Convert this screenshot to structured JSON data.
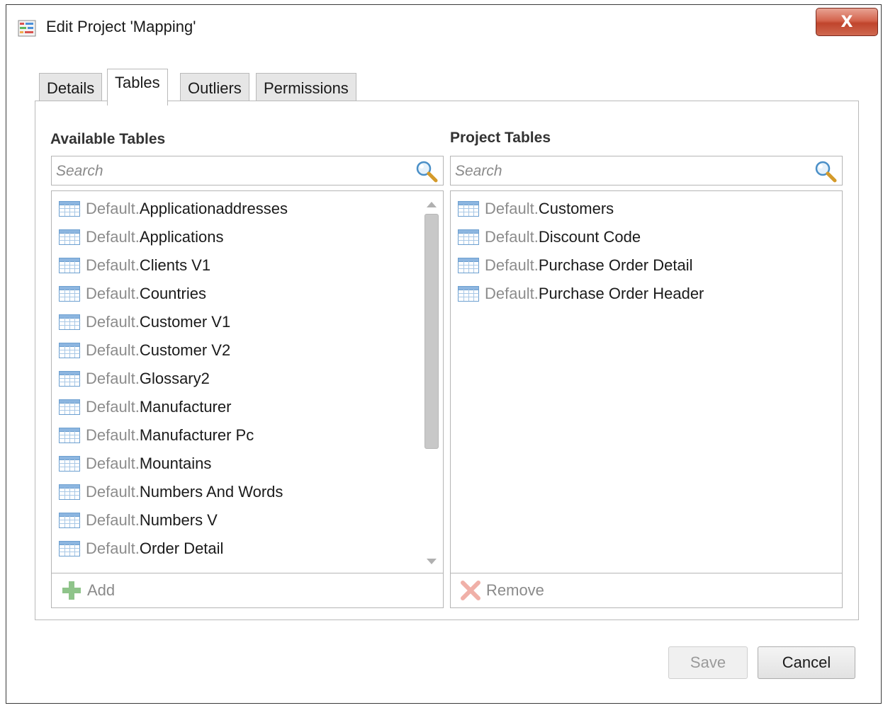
{
  "window": {
    "title": "Edit Project 'Mapping'",
    "close_symbol": "X",
    "close_color": "#c9503a"
  },
  "tabs": [
    {
      "label": "Details",
      "active": false
    },
    {
      "label": "Tables",
      "active": true
    },
    {
      "label": "Outliers",
      "active": false
    },
    {
      "label": "Permissions",
      "active": false
    }
  ],
  "available": {
    "title": "Available Tables",
    "search_placeholder": "Search",
    "items": [
      {
        "prefix": "Default.",
        "name": "Applicationaddresses"
      },
      {
        "prefix": "Default.",
        "name": "Applications"
      },
      {
        "prefix": "Default.",
        "name": "Clients V1"
      },
      {
        "prefix": "Default.",
        "name": "Countries"
      },
      {
        "prefix": "Default.",
        "name": "Customer V1"
      },
      {
        "prefix": "Default.",
        "name": "Customer V2"
      },
      {
        "prefix": "Default.",
        "name": "Glossary2"
      },
      {
        "prefix": "Default.",
        "name": "Manufacturer"
      },
      {
        "prefix": "Default.",
        "name": "Manufacturer Pc"
      },
      {
        "prefix": "Default.",
        "name": "Mountains"
      },
      {
        "prefix": "Default.",
        "name": "Numbers And Words"
      },
      {
        "prefix": "Default.",
        "name": "Numbers V"
      },
      {
        "prefix": "Default.",
        "name": "Order Detail"
      }
    ],
    "action_label": "Add",
    "action_icon": "plus-icon"
  },
  "project": {
    "title": "Project Tables",
    "search_placeholder": "Search",
    "items": [
      {
        "prefix": "Default.",
        "name": "Customers"
      },
      {
        "prefix": "Default.",
        "name": "Discount Code"
      },
      {
        "prefix": "Default.",
        "name": "Purchase Order Detail"
      },
      {
        "prefix": "Default.",
        "name": "Purchase Order Header"
      }
    ],
    "action_label": "Remove",
    "action_icon": "remove-x-icon"
  },
  "buttons": {
    "save_label": "Save",
    "save_disabled": true,
    "cancel_label": "Cancel"
  }
}
